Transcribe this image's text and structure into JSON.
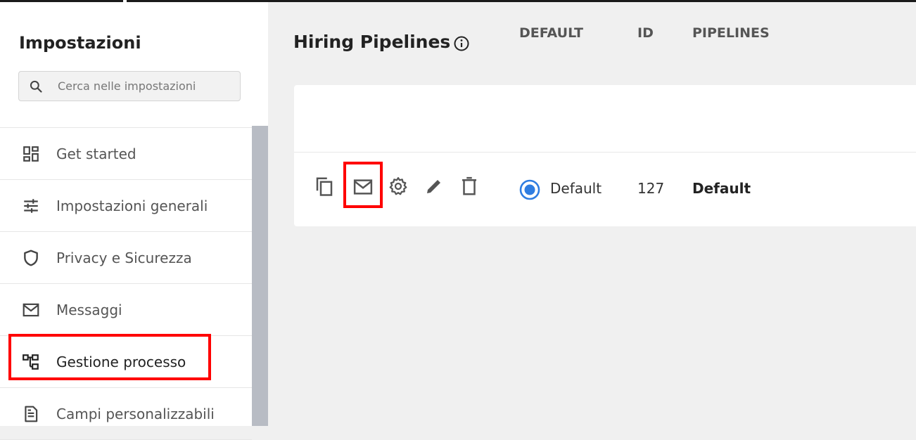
{
  "sidebar": {
    "title": "Impostazioni",
    "search": {
      "placeholder": "Cerca nelle impostazioni",
      "value": ""
    },
    "items": [
      {
        "label": "Get started",
        "icon": "dashboard-icon"
      },
      {
        "label": "Impostazioni generali",
        "icon": "sliders-icon"
      },
      {
        "label": "Privacy e Sicurezza",
        "icon": "shield-icon"
      },
      {
        "label": "Messaggi",
        "icon": "mail-icon"
      },
      {
        "label": "Gestione processo",
        "icon": "process-tree-icon",
        "active": true
      },
      {
        "label": "Campi personalizzabili",
        "icon": "document-icon"
      }
    ]
  },
  "main": {
    "title": "Hiring Pipelines",
    "table": {
      "columns": [
        "DEFAULT",
        "ID",
        "PIPELINES"
      ],
      "rows": [
        {
          "default_selected": true,
          "default_label": "Default",
          "id": "127",
          "pipeline": "Default"
        }
      ],
      "row_actions": [
        "copy-icon",
        "mail-icon",
        "gear-icon",
        "pencil-icon",
        "trash-icon"
      ]
    }
  },
  "colors": {
    "highlight": "#ff0000",
    "radio_accent": "#2f7de1",
    "scrollbar": "#b8bcc4"
  }
}
